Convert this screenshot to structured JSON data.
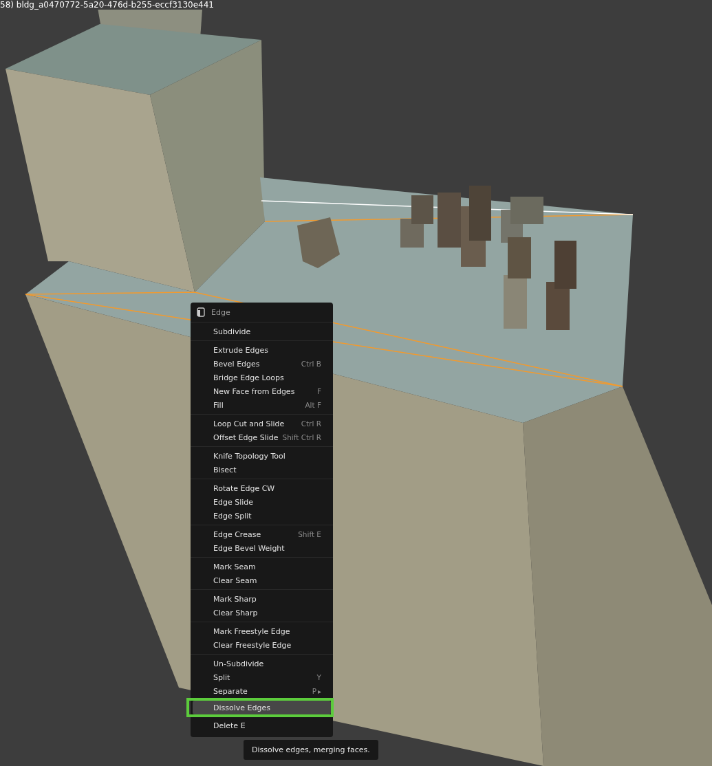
{
  "viewport": {
    "object_label": "58) bldg_a0470772-5a20-476d-b255-eccf3130e441"
  },
  "menu": {
    "title": "Edge",
    "groups": [
      {
        "items": [
          {
            "label": "Subdivide",
            "selected": false
          }
        ]
      },
      {
        "items": [
          {
            "label": "Extrude Edges",
            "selected": false
          },
          {
            "label": "Bevel Edges",
            "shortcut": "Ctrl B",
            "selected": false
          },
          {
            "label": "Bridge Edge Loops",
            "selected": false
          },
          {
            "label": "New Face from Edges",
            "shortcut": "F",
            "selected": false
          },
          {
            "label": "Fill",
            "shortcut": "Alt F",
            "selected": false
          }
        ]
      },
      {
        "items": [
          {
            "label": "Loop Cut and Slide",
            "shortcut": "Ctrl R",
            "selected": false
          },
          {
            "label": "Offset Edge Slide",
            "shortcut": "Shift Ctrl R",
            "selected": false
          }
        ]
      },
      {
        "items": [
          {
            "label": "Knife Topology Tool",
            "selected": false
          },
          {
            "label": "Bisect",
            "selected": false
          }
        ]
      },
      {
        "items": [
          {
            "label": "Rotate Edge CW",
            "selected": false
          },
          {
            "label": "Edge Slide",
            "selected": false
          },
          {
            "label": "Edge Split",
            "selected": false
          }
        ]
      },
      {
        "items": [
          {
            "label": "Edge Crease",
            "shortcut": "Shift E",
            "selected": false
          },
          {
            "label": "Edge Bevel Weight",
            "selected": false
          }
        ]
      },
      {
        "items": [
          {
            "label": "Mark Seam",
            "selected": false
          },
          {
            "label": "Clear Seam",
            "selected": false
          }
        ]
      },
      {
        "items": [
          {
            "label": "Mark Sharp",
            "selected": false
          },
          {
            "label": "Clear Sharp",
            "selected": false
          }
        ]
      },
      {
        "items": [
          {
            "label": "Mark Freestyle Edge",
            "selected": false
          },
          {
            "label": "Clear Freestyle Edge",
            "selected": false
          }
        ]
      },
      {
        "items": [
          {
            "label": "Un-Subdivide",
            "selected": false
          },
          {
            "label": "Split",
            "shortcut": "Y",
            "selected": false
          },
          {
            "label": "Separate",
            "shortcut": "P",
            "submenu_arrow": "▸",
            "selected": false
          },
          {
            "label": "Dissolve Edges",
            "selected": true
          },
          {
            "label": "Delete E",
            "selected": false
          }
        ]
      }
    ]
  },
  "tooltip": {
    "text": "Dissolve edges, merging faces."
  }
}
